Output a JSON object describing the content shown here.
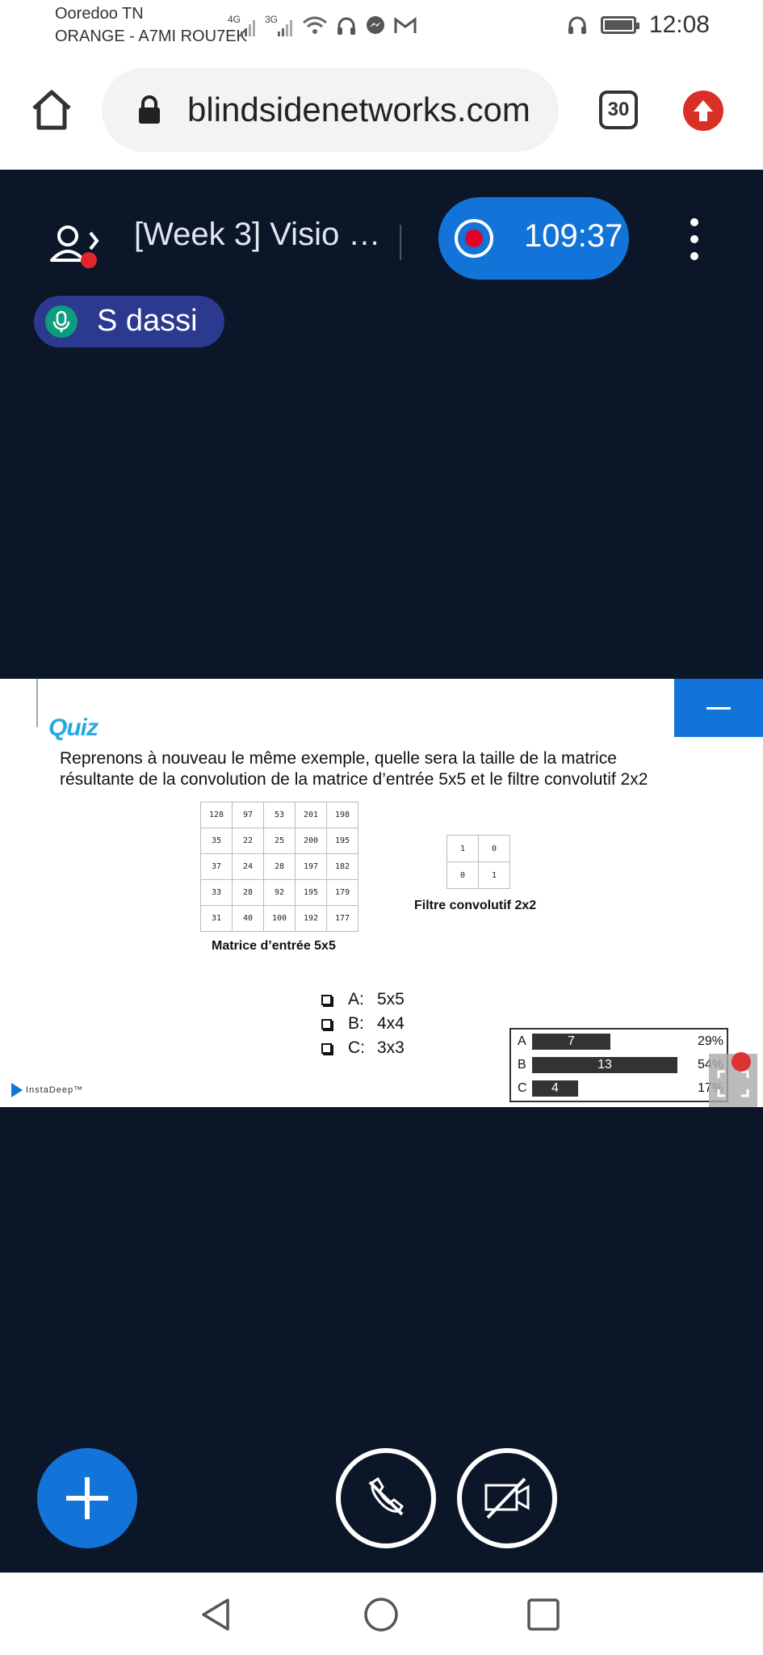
{
  "status_bar": {
    "carrier_line1": "Ooredoo TN",
    "carrier_line2": "ORANGE - A7MI ROU7EK",
    "net1": "4G",
    "net2": "3G",
    "time": "12:08",
    "icons": [
      "signal-4g-icon",
      "signal-3g-icon",
      "wifi-icon",
      "headphones-icon",
      "messenger-icon",
      "gmail-icon",
      "headset-icon",
      "battery-icon"
    ]
  },
  "browser": {
    "url": "blindsidenetworks.com",
    "tab_count": "30",
    "icons": [
      "home-icon",
      "lock-icon",
      "tabs-icon",
      "update-icon"
    ]
  },
  "meeting": {
    "title": "[Week 3] Visio …",
    "recording_time": "109:37",
    "talker": "S dassi"
  },
  "slide": {
    "heading": "Quiz",
    "question_line1": "Reprenons à nouveau le même exemple, quelle sera la taille de la matrice",
    "question_line2": "résultante de la convolution de la matrice d’entrée 5x5 et le filtre convolutif 2x2",
    "input_matrix": [
      [
        "128",
        "97",
        "53",
        "201",
        "198"
      ],
      [
        "35",
        "22",
        "25",
        "200",
        "195"
      ],
      [
        "37",
        "24",
        "28",
        "197",
        "182"
      ],
      [
        "33",
        "28",
        "92",
        "195",
        "179"
      ],
      [
        "31",
        "40",
        "100",
        "192",
        "177"
      ]
    ],
    "input_caption": "Matrice d’entrée 5x5",
    "filter_matrix": [
      [
        "1",
        "0"
      ],
      [
        "0",
        "1"
      ]
    ],
    "filter_caption": "Filtre convolutif 2x2",
    "options": [
      {
        "letter": "A:",
        "text": "5x5"
      },
      {
        "letter": "B:",
        "text": "4x4"
      },
      {
        "letter": "C:",
        "text": "3x3"
      }
    ],
    "logo_text": "InstaDeep™"
  },
  "poll": {
    "rows": [
      {
        "key": "A",
        "count": "7",
        "pct": "29%",
        "fraction": 0.29
      },
      {
        "key": "B",
        "count": "13",
        "pct": "54%",
        "fraction": 0.54
      },
      {
        "key": "C",
        "count": "4",
        "pct": "17%",
        "fraction": 0.17
      }
    ]
  },
  "controls": {
    "icons": [
      "plus-icon",
      "hangup-audio-icon",
      "camera-off-icon"
    ]
  },
  "colors": {
    "app_background": "#0b1628",
    "accent_blue": "#1274d9",
    "record_red": "#e3002a",
    "talker_pill": "#2b3a8f"
  }
}
